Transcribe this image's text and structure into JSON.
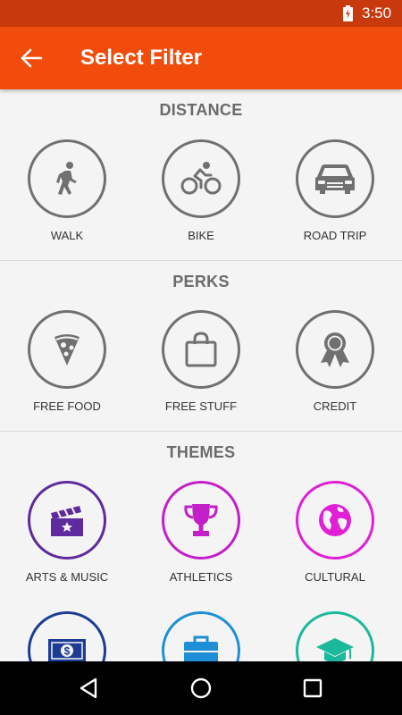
{
  "status_bar": {
    "time": "3:50"
  },
  "app_bar": {
    "title": "Select Filter"
  },
  "sections": {
    "distance": {
      "title": "DISTANCE",
      "items": [
        {
          "label": "WALK",
          "icon": "walk-icon",
          "color": "#707070"
        },
        {
          "label": "BIKE",
          "icon": "bike-icon",
          "color": "#707070"
        },
        {
          "label": "ROAD TRIP",
          "icon": "car-icon",
          "color": "#707070"
        }
      ]
    },
    "perks": {
      "title": "PERKS",
      "items": [
        {
          "label": "FREE FOOD",
          "icon": "pizza-icon",
          "color": "#707070"
        },
        {
          "label": "FREE STUFF",
          "icon": "shopping-bag-icon",
          "color": "#707070"
        },
        {
          "label": "CREDIT",
          "icon": "award-ribbon-icon",
          "color": "#707070"
        }
      ]
    },
    "themes": {
      "title": "THEMES",
      "items": [
        {
          "label": "ARTS & MUSIC",
          "icon": "clapperboard-icon",
          "color": "#5e2a9e"
        },
        {
          "label": "ATHLETICS",
          "icon": "trophy-icon",
          "color": "#c21fc8"
        },
        {
          "label": "CULTURAL",
          "icon": "globe-icon",
          "color": "#e01fd6"
        },
        {
          "label": "",
          "icon": "money-icon",
          "color": "#1c3c94"
        },
        {
          "label": "",
          "icon": "briefcase-icon",
          "color": "#1e8fd6"
        },
        {
          "label": "",
          "icon": "graduation-cap-icon",
          "color": "#1ab99c"
        }
      ]
    }
  }
}
